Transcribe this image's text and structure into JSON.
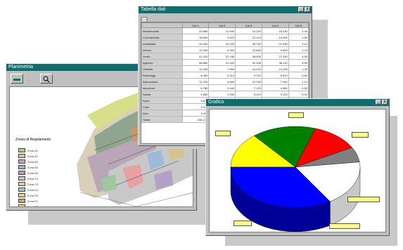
{
  "map_window": {
    "title": "Planimetria",
    "toolbar": [
      {
        "icon": "pan-icon"
      },
      {
        "icon": "zoom-icon"
      }
    ],
    "legend_title": "Zones di Regolamento",
    "legend": [
      {
        "color": "#b7c78a",
        "label": "Zona A1"
      },
      {
        "color": "#d8c49a",
        "label": "Zona A2"
      },
      {
        "color": "#c7a4b4",
        "label": "Zona B1"
      },
      {
        "color": "#9fb0c8",
        "label": "Zona B2"
      },
      {
        "color": "#b89ab8",
        "label": "Zona B3"
      },
      {
        "color": "#c4c4c4",
        "label": "Zona C1"
      },
      {
        "color": "#e3c6a8",
        "label": "Zona C2"
      },
      {
        "color": "#a7c7a7",
        "label": "Zona D1"
      },
      {
        "color": "#d9d28a",
        "label": "Zona D2"
      },
      {
        "color": "#c9a27a",
        "label": "Zona E1"
      },
      {
        "color": "#e8e070",
        "label": "Zona E2"
      },
      {
        "color": "#8c8c8c",
        "label": "Zona F"
      }
    ]
  },
  "table_window": {
    "title": "Tabella dati",
    "columns": [
      "",
      "Col 1",
      "Col 2",
      "Col 3",
      "Col 4",
      "Col 5"
    ],
    "rows": [
      [
        "Residenziale",
        "24.880",
        "12.540",
        "31.240",
        "18.230",
        "2.40"
      ],
      [
        "Commerciale",
        "18.650",
        "9.870",
        "22.110",
        "14.900",
        "1.80"
      ],
      [
        "Industriale",
        "32.420",
        "15.220",
        "28.760",
        "21.330",
        "3.10"
      ],
      [
        "Servizi",
        "12.300",
        "6.420",
        "15.880",
        "9.650",
        "1.20"
      ],
      [
        "Verde",
        "41.240",
        "22.180",
        "38.450",
        "27.200",
        "4.50"
      ],
      [
        "Agricolo",
        "56.880",
        "31.020",
        "52.330",
        "36.110",
        "5.90"
      ],
      [
        "Viabilita",
        "14.760",
        "7.890",
        "16.240",
        "10.020",
        "1.30"
      ],
      [
        "Parcheggi",
        "8.450",
        "4.210",
        "9.120",
        "5.870",
        "0.80"
      ],
      [
        "Attrezzature",
        "11.230",
        "5.890",
        "12.760",
        "7.940",
        "1.10"
      ],
      [
        "Istruzione",
        "6.780",
        "3.440",
        "7.120",
        "4.560",
        "0.60"
      ],
      [
        "Sanita",
        "4.560",
        "2.340",
        "5.010",
        "3.120",
        "0.40"
      ],
      [
        "Sport",
        "9.870",
        "5.120",
        "10.440",
        "6.780",
        "0.90"
      ],
      [
        "Culto",
        "2.340",
        "1.210",
        "2.560",
        "1.670",
        "0.20"
      ],
      [
        "Altro",
        "3.450",
        "1.780",
        "3.890",
        "2.340",
        "0.30"
      ],
      [
        "Totale",
        "248.210",
        "129.140",
        "255.910",
        "169.740",
        "24.50"
      ]
    ]
  },
  "chart_window": {
    "title": "Grafico",
    "chart_data": {
      "type": "pie",
      "slices": [
        {
          "color": "#ffff00",
          "value": 14
        },
        {
          "color": "#008000",
          "value": 16
        },
        {
          "color": "#ff0000",
          "value": 12
        },
        {
          "color": "#808080",
          "value": 6
        },
        {
          "color": "#ffffff",
          "value": 18
        },
        {
          "color": "#0000ff",
          "value": 34
        }
      ],
      "callouts": [
        "",
        "",
        "",
        "",
        "",
        ""
      ]
    }
  }
}
